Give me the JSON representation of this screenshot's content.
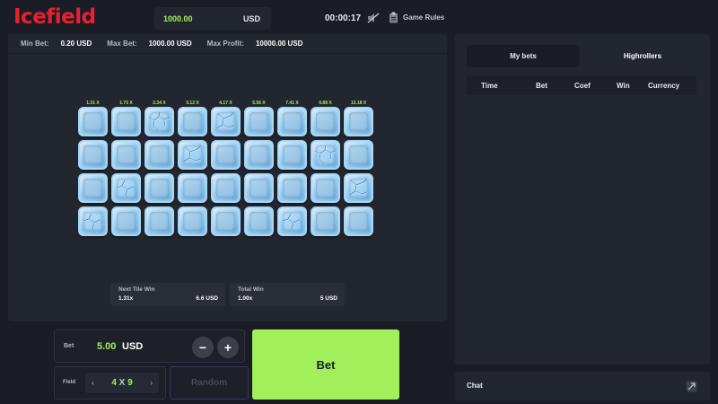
{
  "app": {
    "logo": "Icefield"
  },
  "header": {
    "balance": "1000.00",
    "currency": "USD",
    "timer": "00:00:17",
    "rules_label": "Game Rules"
  },
  "limits": {
    "min_bet_label": "Min Bet:",
    "min_bet": "0.20 USD",
    "max_bet_label": "Max Bet:",
    "max_bet": "1000.00 USD",
    "max_profit_label": "Max Profit:",
    "max_profit": "10000.00 USD"
  },
  "multipliers": [
    "1.31 X",
    "1.75 X",
    "2.34 X",
    "3.12 X",
    "4.17 X",
    "5.56 X",
    "7.41 X",
    "9.88 X",
    "13.18 X"
  ],
  "tiles": [
    [
      0,
      0,
      1,
      0,
      1,
      0,
      0,
      0,
      0
    ],
    [
      0,
      0,
      0,
      1,
      0,
      0,
      0,
      1,
      0
    ],
    [
      0,
      1,
      0,
      0,
      0,
      0,
      0,
      0,
      1
    ],
    [
      1,
      0,
      0,
      0,
      0,
      0,
      1,
      0,
      0
    ]
  ],
  "stats": {
    "next_title": "Next Tile Win",
    "next_mult": "1.31x",
    "next_amount": "6.6 USD",
    "total_title": "Total Win",
    "total_mult": "1.00x",
    "total_amount": "5 USD"
  },
  "controls": {
    "bet_label": "Bet",
    "bet_value": "5.00",
    "bet_currency": "USD",
    "minus": "−",
    "plus": "+",
    "field_label": "Field",
    "field_cols": "4",
    "field_x": "X",
    "field_rows": "9",
    "prev": "‹",
    "next": "›",
    "random_label": "Random",
    "bet_button": "Bet"
  },
  "bets": {
    "tabs": [
      "My bets",
      "Highrollers"
    ],
    "columns": [
      "Time",
      "Bet",
      "Coef",
      "Win",
      "Currency"
    ]
  },
  "chat": {
    "label": "Chat"
  },
  "colors": {
    "accent": "#a2ef5c",
    "brand": "#e8202f",
    "bg": "#1a1d26",
    "panel": "#22262f"
  }
}
